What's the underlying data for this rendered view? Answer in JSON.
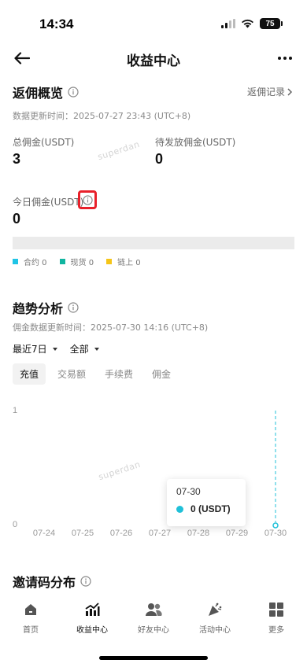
{
  "status_bar": {
    "time": "14:34",
    "battery": "75"
  },
  "nav": {
    "title": "收益中心"
  },
  "overview": {
    "title": "返佣概览",
    "updated": "数据更新时间：2025-07-27 23:43 (UTC+8)",
    "records_link": "返佣记录",
    "total_label": "总佣金(USDT)",
    "total_value": "3",
    "pending_label": "待发放佣金(USDT)",
    "pending_value": "0",
    "today_label": "今日佣金(USDT)",
    "today_value": "0",
    "legend": [
      {
        "label": "合约 0",
        "color": "#1fc4e6"
      },
      {
        "label": "现货 0",
        "color": "#10b5a0"
      },
      {
        "label": "链上 0",
        "color": "#f5c518"
      }
    ]
  },
  "watermark": "superdan",
  "trend": {
    "title": "趋势分析",
    "updated": "佣金数据更新时间：2025-07-30 14:16 (UTC+8)",
    "range_select": "最近7日",
    "type_select": "全部",
    "tabs": [
      "充值",
      "交易额",
      "手续费",
      "佣金"
    ],
    "active_tab": "充值"
  },
  "chart_data": {
    "type": "line",
    "x": [
      "07-24",
      "07-25",
      "07-26",
      "07-27",
      "07-28",
      "07-29",
      "07-30"
    ],
    "series": [
      {
        "values": [
          0,
          0,
          0,
          0,
          0,
          0,
          0
        ],
        "color": "#20c0d8"
      }
    ],
    "y_ticks": [
      "1",
      "0"
    ],
    "ylim": [
      0,
      1
    ],
    "grid": false,
    "tooltip": {
      "date": "07-30",
      "value": "0 (USDT)"
    }
  },
  "invite": {
    "title": "邀请码分布"
  },
  "bottom_nav": [
    {
      "label": "首页",
      "icon": "home-icon"
    },
    {
      "label": "收益中心",
      "icon": "earnings-chart-icon"
    },
    {
      "label": "好友中心",
      "icon": "friends-icon"
    },
    {
      "label": "活动中心",
      "icon": "party-icon"
    },
    {
      "label": "更多",
      "icon": "grid-icon"
    }
  ]
}
